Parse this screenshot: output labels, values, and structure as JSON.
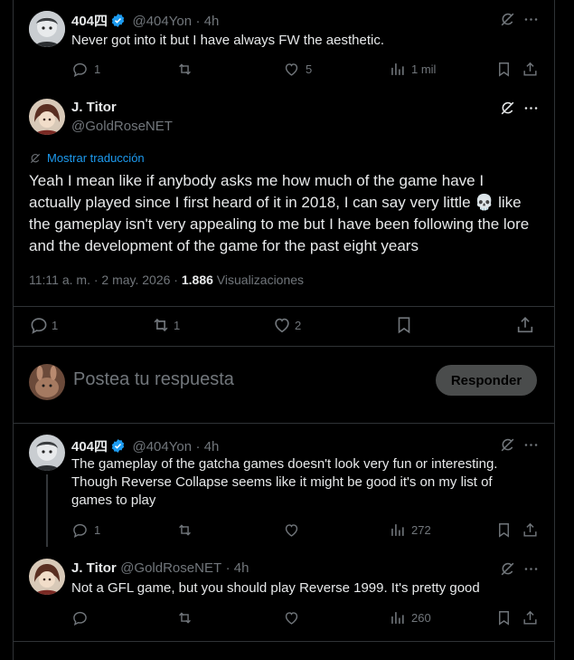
{
  "posts": [
    {
      "author": "404四",
      "handle": "@404Yon",
      "time": "4h",
      "text": "Never got into it but I have always FW the aesthetic.",
      "replies": "1",
      "likes": "5",
      "views": "1 mil"
    },
    {
      "author": "404四",
      "handle": "@404Yon",
      "time": "4h",
      "text": "The gameplay of the gatcha games doesn't look very fun or interesting. Though Reverse Collapse seems like it might be good it's on my list of games to play",
      "replies": "1",
      "views": "272"
    },
    {
      "author": "J. Titor",
      "handle": "@GoldRoseNET",
      "time": "4h",
      "text": "Not a GFL game, but you should play Reverse 1999. It's pretty good",
      "views": "260"
    }
  ],
  "main": {
    "author": "J. Titor",
    "handle": "@GoldRoseNET",
    "translate": "Mostrar traducción",
    "text": "Yeah I mean like if anybody asks me how much of the game have I actually played since I first heard of it in 2018, I can say very little 💀 like the gameplay isn't very appealing to me but I have been following the lore and the development of the game for the past eight years",
    "time": "11:11 a. m. · 2 may. 2026 ·",
    "views_count": "1.886",
    "views_label": "Visualizaciones",
    "replies": "1",
    "reposts": "1",
    "likes": "2"
  },
  "composer": {
    "placeholder": "Postea tu respuesta",
    "reply_label": "Responder"
  },
  "colors": {
    "accent": "#1d9bf0",
    "muted": "#71767b",
    "text": "#e7e9ea"
  }
}
